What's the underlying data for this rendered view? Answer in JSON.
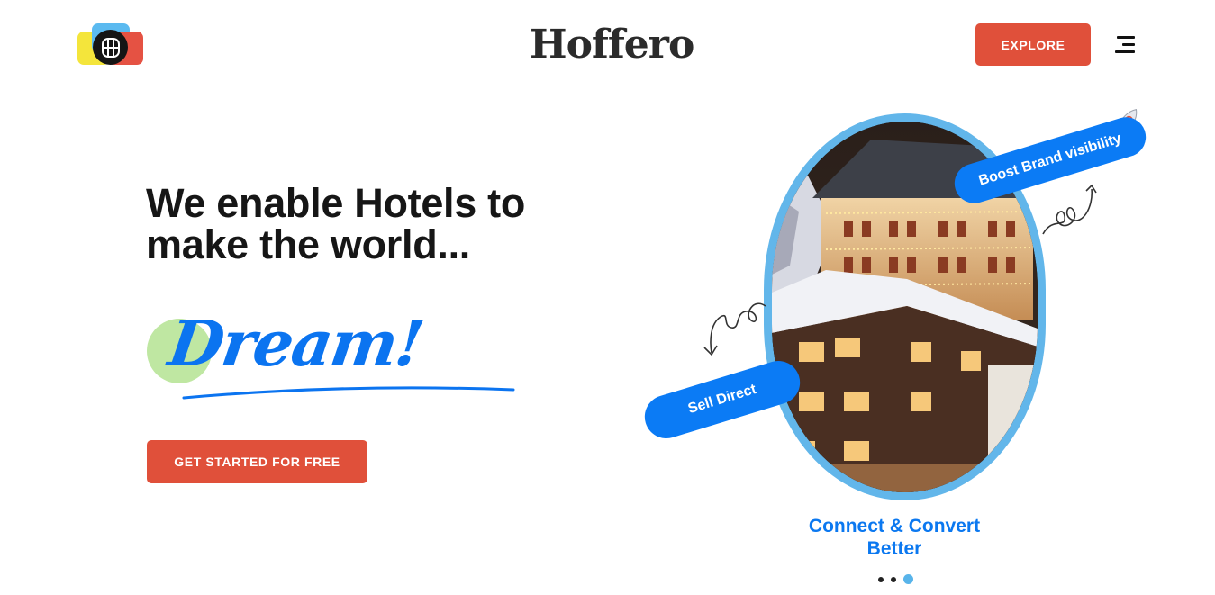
{
  "header": {
    "brand_name": "Hoffero",
    "explore_label": "EXPLORE",
    "logo_icon": "brand-logo-icon",
    "menu_icon": "hamburger-menu-icon"
  },
  "hero": {
    "headline": "We enable Hotels to make the world...",
    "highlight_word": "Dream!",
    "cta_label": "GET STARTED FOR FREE"
  },
  "showcase": {
    "pill_boost": "Boost Brand visibility",
    "pill_sell": "Sell Direct",
    "caption_line1": "Connect & Convert",
    "caption_line2": "Better",
    "slide_dots_total": 3,
    "slide_active_index": 3
  },
  "colors": {
    "accent_red": "#e0503a",
    "accent_blue": "#0b7bf5",
    "frame_blue": "#62b6ea",
    "blob_green": "#bfe7a2"
  }
}
